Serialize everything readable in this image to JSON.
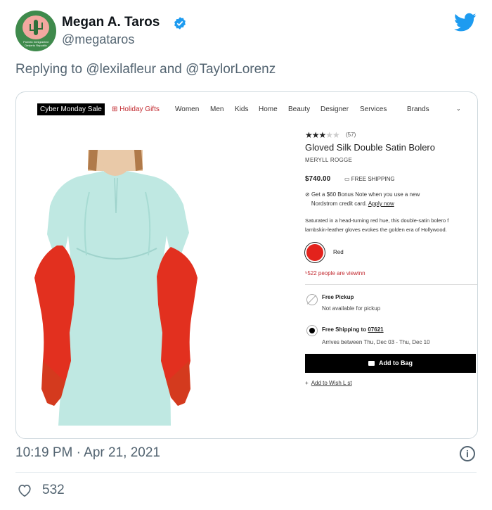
{
  "tweet": {
    "name": "Megan A. Taros",
    "handle": "@megataros",
    "reply_prefix": "Replying to ",
    "reply_mention_1": "@lexilafleur",
    "reply_and": " and ",
    "reply_mention_2": "@TaylorLorenz",
    "timestamp": "10:19 PM · Apr 21, 2021",
    "likes": "532",
    "avatar_text": "Pomelo Inmigranted Desierto Republic",
    "info_glyph": "i"
  },
  "shop": {
    "nav": {
      "sale": "Cyber Monday Sale",
      "gifts": "Holiday Gifts",
      "women": "Women",
      "men": "Men",
      "kids": "Kids",
      "home": "Home",
      "beauty": "Beauty",
      "designer": "Designer",
      "services": "Services",
      "brands": "Brands"
    },
    "product": {
      "rating_count": "(57)",
      "title": "Gloved Silk Double Satin Bolero",
      "brand": "MERYLL ROGGE",
      "price": "$740.00",
      "shipping": "FREE SHIPPING",
      "bonus_line1": "Get a $60 Bonus Note when you use a new",
      "bonus_line2": "Nordstrom credit card.",
      "apply": "Apply now",
      "desc_line1": "Saturated in a head-turning red hue, this double-satin bolero f",
      "desc_line2": "lambskin-leather gloves evokes the golden era of Hollywood.",
      "color": "Red",
      "viewing": "⁵522 people are viewinn",
      "pickup_title": "Free Pickup",
      "pickup_note": "Not available for pickup",
      "ship_to": "Free Shipping to ",
      "zip": "07621",
      "arrives": "Arrives between Thu, Dec 03 - Thu, Dec 10",
      "add_to_bag": "Add to Bag",
      "wish_plus": "+",
      "wish": "Add to Wish L st"
    }
  },
  "colors": {
    "accent_blue": "#1d9bf0",
    "muted": "#536471",
    "glove_red": "#e3221c",
    "dress_mint": "#bfe8e2"
  }
}
